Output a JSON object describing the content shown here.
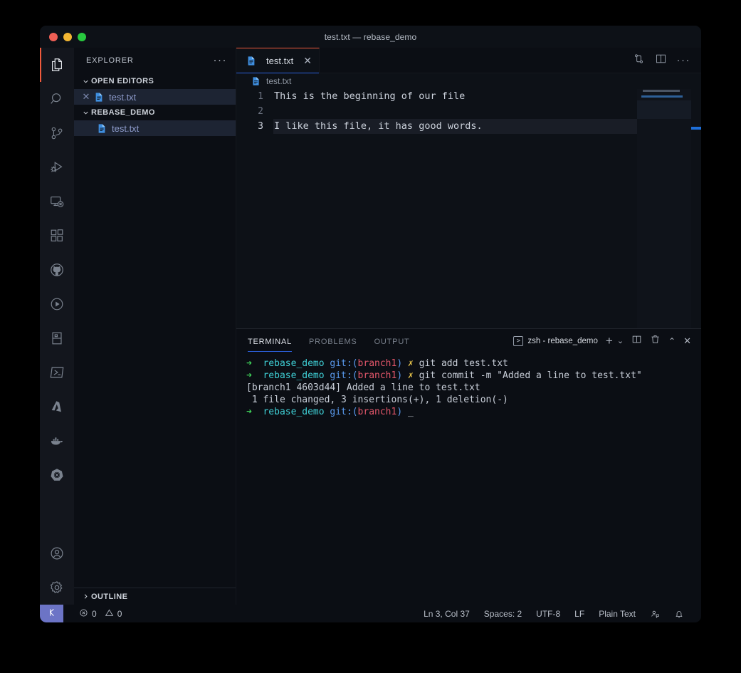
{
  "window": {
    "title": "test.txt — rebase_demo",
    "traffic_lights": [
      "close",
      "minimize",
      "zoom"
    ]
  },
  "activity_bar": {
    "items": [
      {
        "name": "explorer",
        "icon": "files-icon",
        "active": true
      },
      {
        "name": "search",
        "icon": "search-icon",
        "active": false
      },
      {
        "name": "source-control",
        "icon": "source-control-icon",
        "active": false
      },
      {
        "name": "run-and-debug",
        "icon": "run-debug-icon",
        "active": false
      },
      {
        "name": "remote-explorer",
        "icon": "remote-explorer-icon",
        "active": false
      },
      {
        "name": "extensions",
        "icon": "extensions-icon",
        "active": false
      },
      {
        "name": "github",
        "icon": "github-icon",
        "active": false
      },
      {
        "name": "test-runner",
        "icon": "play-circle-icon",
        "active": false
      },
      {
        "name": "database",
        "icon": "database-panel-icon",
        "active": false
      },
      {
        "name": "powershell",
        "icon": "powershell-icon",
        "active": false
      },
      {
        "name": "azure",
        "icon": "azure-icon",
        "active": false
      },
      {
        "name": "docker",
        "icon": "docker-whale-icon",
        "active": false
      },
      {
        "name": "kubernetes",
        "icon": "kubernetes-helm-icon",
        "active": false
      }
    ],
    "bottom_items": [
      {
        "name": "accounts",
        "icon": "account-icon"
      },
      {
        "name": "manage-settings",
        "icon": "gear-icon"
      }
    ]
  },
  "sidebar": {
    "title": "EXPLORER",
    "more_actions": "···",
    "sections": [
      {
        "label": "OPEN EDITORS",
        "expanded": true,
        "items": [
          {
            "label": "test.txt",
            "selected": true,
            "closable": true
          }
        ]
      },
      {
        "label": "REBASE_DEMO",
        "expanded": true,
        "items": [
          {
            "label": "test.txt",
            "selected": true,
            "closable": false
          }
        ]
      }
    ],
    "outline": {
      "label": "OUTLINE",
      "expanded": false
    }
  },
  "editor": {
    "tabs": [
      {
        "label": "test.txt",
        "active": true,
        "close_glyph": "✕",
        "icon": "text-file-icon"
      }
    ],
    "actions": [
      {
        "name": "open-changes-icon"
      },
      {
        "name": "split-editor-icon"
      },
      {
        "name": "more-actions-icon",
        "glyph": "···"
      }
    ],
    "breadcrumb": "test.txt",
    "lines": [
      {
        "num": "1",
        "text": "This is the beginning of our file",
        "active": false
      },
      {
        "num": "2",
        "text": "",
        "active": false
      },
      {
        "num": "3",
        "text": "I like this file, it has good words.",
        "active": true
      }
    ]
  },
  "panel": {
    "tabs": [
      {
        "label": "TERMINAL",
        "active": true
      },
      {
        "label": "PROBLEMS",
        "active": false
      },
      {
        "label": "OUTPUT",
        "active": false
      }
    ],
    "terminal_selector": "zsh - rebase_demo",
    "actions": [
      {
        "name": "new-terminal-icon",
        "glyph": "+"
      },
      {
        "name": "terminal-dropdown-icon",
        "glyph": "⌄"
      },
      {
        "name": "split-terminal-icon"
      },
      {
        "name": "kill-terminal-icon"
      },
      {
        "name": "maximize-panel-icon",
        "glyph": "⌃"
      },
      {
        "name": "close-panel-icon",
        "glyph": "✕"
      }
    ],
    "terminal_lines": [
      {
        "type": "prompt",
        "segments": [
          {
            "text": "➜ ",
            "color": "green"
          },
          {
            "text": " rebase_demo ",
            "color": "cyan"
          },
          {
            "text": "git:(",
            "color": "blue"
          },
          {
            "text": "branch1",
            "color": "red"
          },
          {
            "text": ")",
            "color": "blue"
          },
          {
            "text": " ✗ ",
            "color": "yellow"
          },
          {
            "text": "git add test.txt",
            "color": "white"
          }
        ]
      },
      {
        "type": "prompt",
        "segments": [
          {
            "text": "➜ ",
            "color": "green"
          },
          {
            "text": " rebase_demo ",
            "color": "cyan"
          },
          {
            "text": "git:(",
            "color": "blue"
          },
          {
            "text": "branch1",
            "color": "red"
          },
          {
            "text": ")",
            "color": "blue"
          },
          {
            "text": " ✗ ",
            "color": "yellow"
          },
          {
            "text": "git commit -m \"Added a line to test.txt\"",
            "color": "white"
          }
        ]
      },
      {
        "type": "output",
        "segments": [
          {
            "text": "[branch1 4603d44] Added a line to test.txt",
            "color": "white"
          }
        ]
      },
      {
        "type": "output",
        "segments": [
          {
            "text": " 1 file changed, 3 insertions(+), 1 deletion(-)",
            "color": "white"
          }
        ]
      },
      {
        "type": "prompt",
        "segments": [
          {
            "text": "➜ ",
            "color": "green"
          },
          {
            "text": " rebase_demo ",
            "color": "cyan"
          },
          {
            "text": "git:(",
            "color": "blue"
          },
          {
            "text": "branch1",
            "color": "red"
          },
          {
            "text": ")",
            "color": "blue"
          },
          {
            "text": " _",
            "color": "white"
          }
        ]
      }
    ]
  },
  "status_bar": {
    "remote_icon": "remote-window-icon",
    "errors": "0",
    "warnings": "0",
    "cursor_position": "Ln 3, Col 37",
    "indentation": "Spaces: 2",
    "encoding": "UTF-8",
    "eol": "LF",
    "language": "Plain Text",
    "feedback_icon": "feedback-icon",
    "notifications_icon": "bell-icon"
  },
  "colors": {
    "accent_blue": "#2b5fd9",
    "tab_top_border": "#f05a3c",
    "remote_badge": "#6c74c6",
    "terminal_green": "#3fd45a",
    "terminal_cyan": "#3fd0d6",
    "terminal_red": "#e2566a",
    "terminal_yellow": "#e6c34a",
    "file_icon_blue": "#3f8fe0"
  }
}
